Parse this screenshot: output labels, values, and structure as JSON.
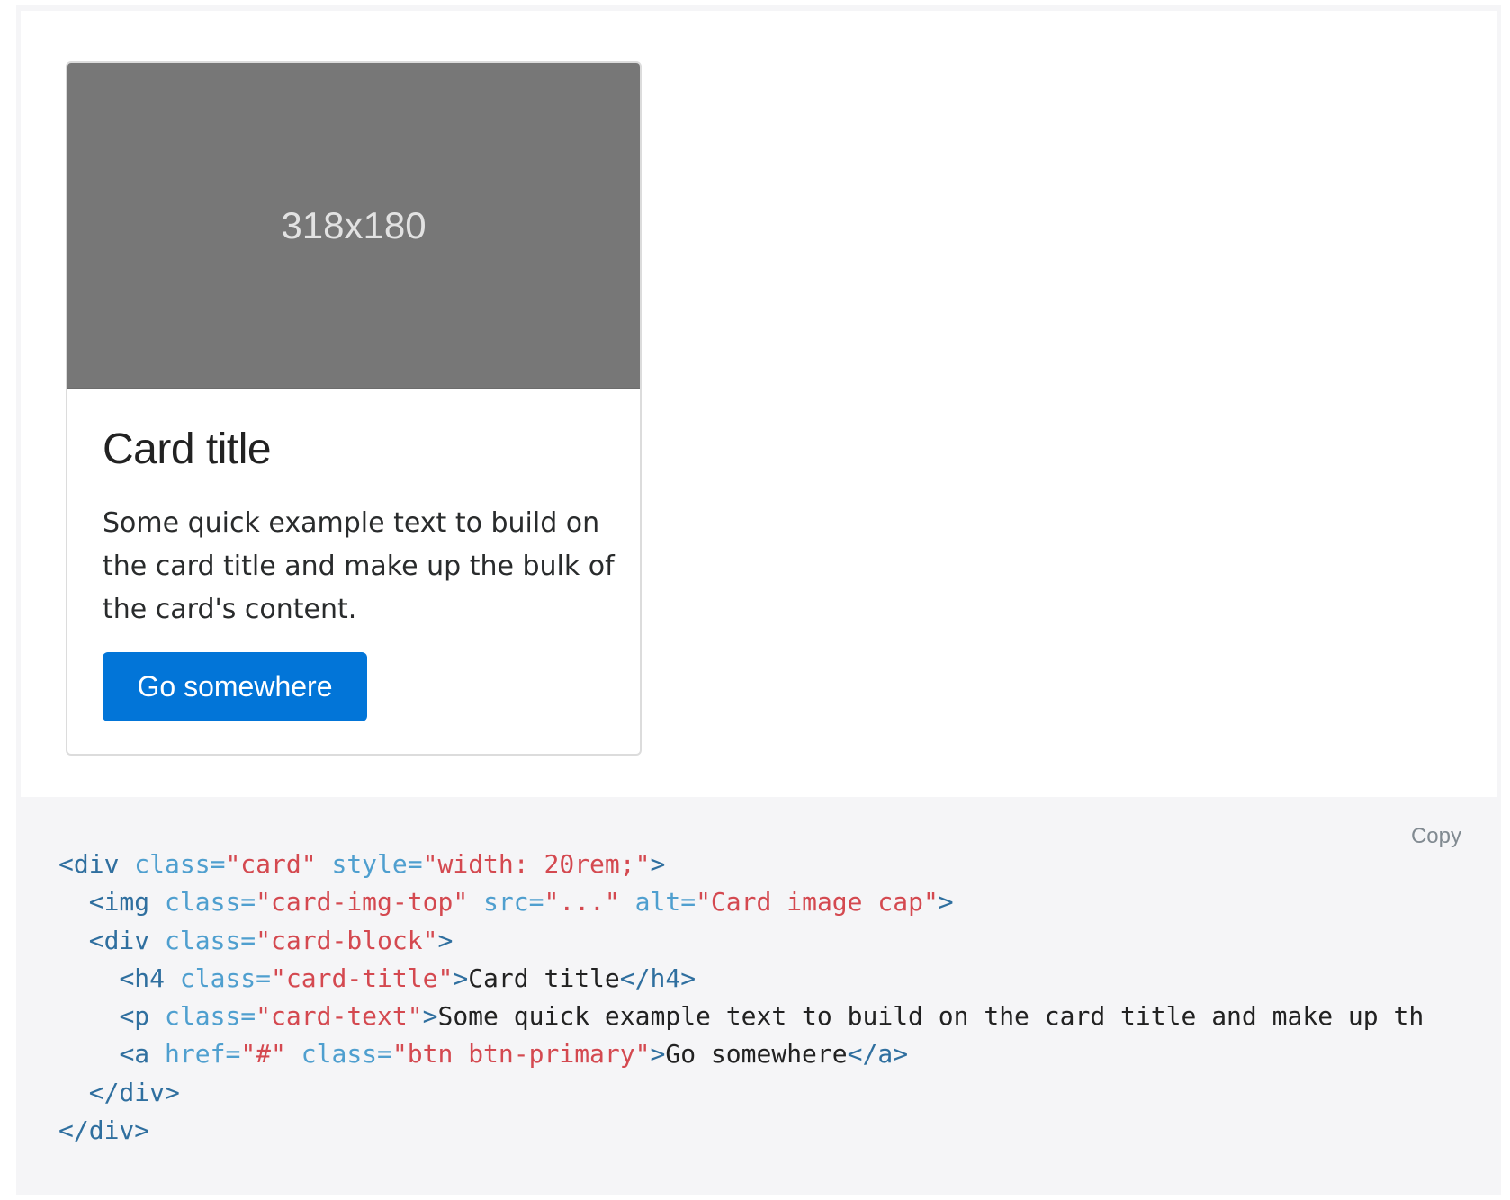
{
  "card": {
    "image_label": "318x180",
    "title": "Card title",
    "text": "Some quick example text to build on the card title and make up the bulk of the card's content.",
    "button_label": "Go somewhere",
    "button_color": "#0275d8"
  },
  "code": {
    "copy_label": "Copy",
    "lines": [
      {
        "indent": "",
        "tokens": [
          {
            "t": "tag",
            "v": "<div"
          },
          {
            "t": "text",
            "v": " "
          },
          {
            "t": "attr",
            "v": "class="
          },
          {
            "t": "str",
            "v": "\"card\""
          },
          {
            "t": "text",
            "v": " "
          },
          {
            "t": "attr",
            "v": "style="
          },
          {
            "t": "str",
            "v": "\"width: 20rem;\""
          },
          {
            "t": "tag",
            "v": ">"
          }
        ]
      },
      {
        "indent": "  ",
        "tokens": [
          {
            "t": "tag",
            "v": "<img"
          },
          {
            "t": "text",
            "v": " "
          },
          {
            "t": "attr",
            "v": "class="
          },
          {
            "t": "str",
            "v": "\"card-img-top\""
          },
          {
            "t": "text",
            "v": " "
          },
          {
            "t": "attr",
            "v": "src="
          },
          {
            "t": "str",
            "v": "\"...\""
          },
          {
            "t": "text",
            "v": " "
          },
          {
            "t": "attr",
            "v": "alt="
          },
          {
            "t": "str",
            "v": "\"Card image cap\""
          },
          {
            "t": "tag",
            "v": ">"
          }
        ]
      },
      {
        "indent": "  ",
        "tokens": [
          {
            "t": "tag",
            "v": "<div"
          },
          {
            "t": "text",
            "v": " "
          },
          {
            "t": "attr",
            "v": "class="
          },
          {
            "t": "str",
            "v": "\"card-block\""
          },
          {
            "t": "tag",
            "v": ">"
          }
        ]
      },
      {
        "indent": "    ",
        "tokens": [
          {
            "t": "tag",
            "v": "<h4"
          },
          {
            "t": "text",
            "v": " "
          },
          {
            "t": "attr",
            "v": "class="
          },
          {
            "t": "str",
            "v": "\"card-title\""
          },
          {
            "t": "tag",
            "v": ">"
          },
          {
            "t": "text",
            "v": "Card title"
          },
          {
            "t": "tag",
            "v": "</h4>"
          }
        ]
      },
      {
        "indent": "    ",
        "tokens": [
          {
            "t": "tag",
            "v": "<p"
          },
          {
            "t": "text",
            "v": " "
          },
          {
            "t": "attr",
            "v": "class="
          },
          {
            "t": "str",
            "v": "\"card-text\""
          },
          {
            "t": "tag",
            "v": ">"
          },
          {
            "t": "text",
            "v": "Some quick example text to build on the card title and make up th"
          }
        ]
      },
      {
        "indent": "    ",
        "tokens": [
          {
            "t": "tag",
            "v": "<a"
          },
          {
            "t": "text",
            "v": " "
          },
          {
            "t": "attr",
            "v": "href="
          },
          {
            "t": "str",
            "v": "\"#\""
          },
          {
            "t": "text",
            "v": " "
          },
          {
            "t": "attr",
            "v": "class="
          },
          {
            "t": "str",
            "v": "\"btn btn-primary\""
          },
          {
            "t": "tag",
            "v": ">"
          },
          {
            "t": "text",
            "v": "Go somewhere"
          },
          {
            "t": "tag",
            "v": "</a>"
          }
        ]
      },
      {
        "indent": "  ",
        "tokens": [
          {
            "t": "tag",
            "v": "</div>"
          }
        ]
      },
      {
        "indent": "",
        "tokens": [
          {
            "t": "tag",
            "v": "</div>"
          }
        ]
      }
    ]
  }
}
